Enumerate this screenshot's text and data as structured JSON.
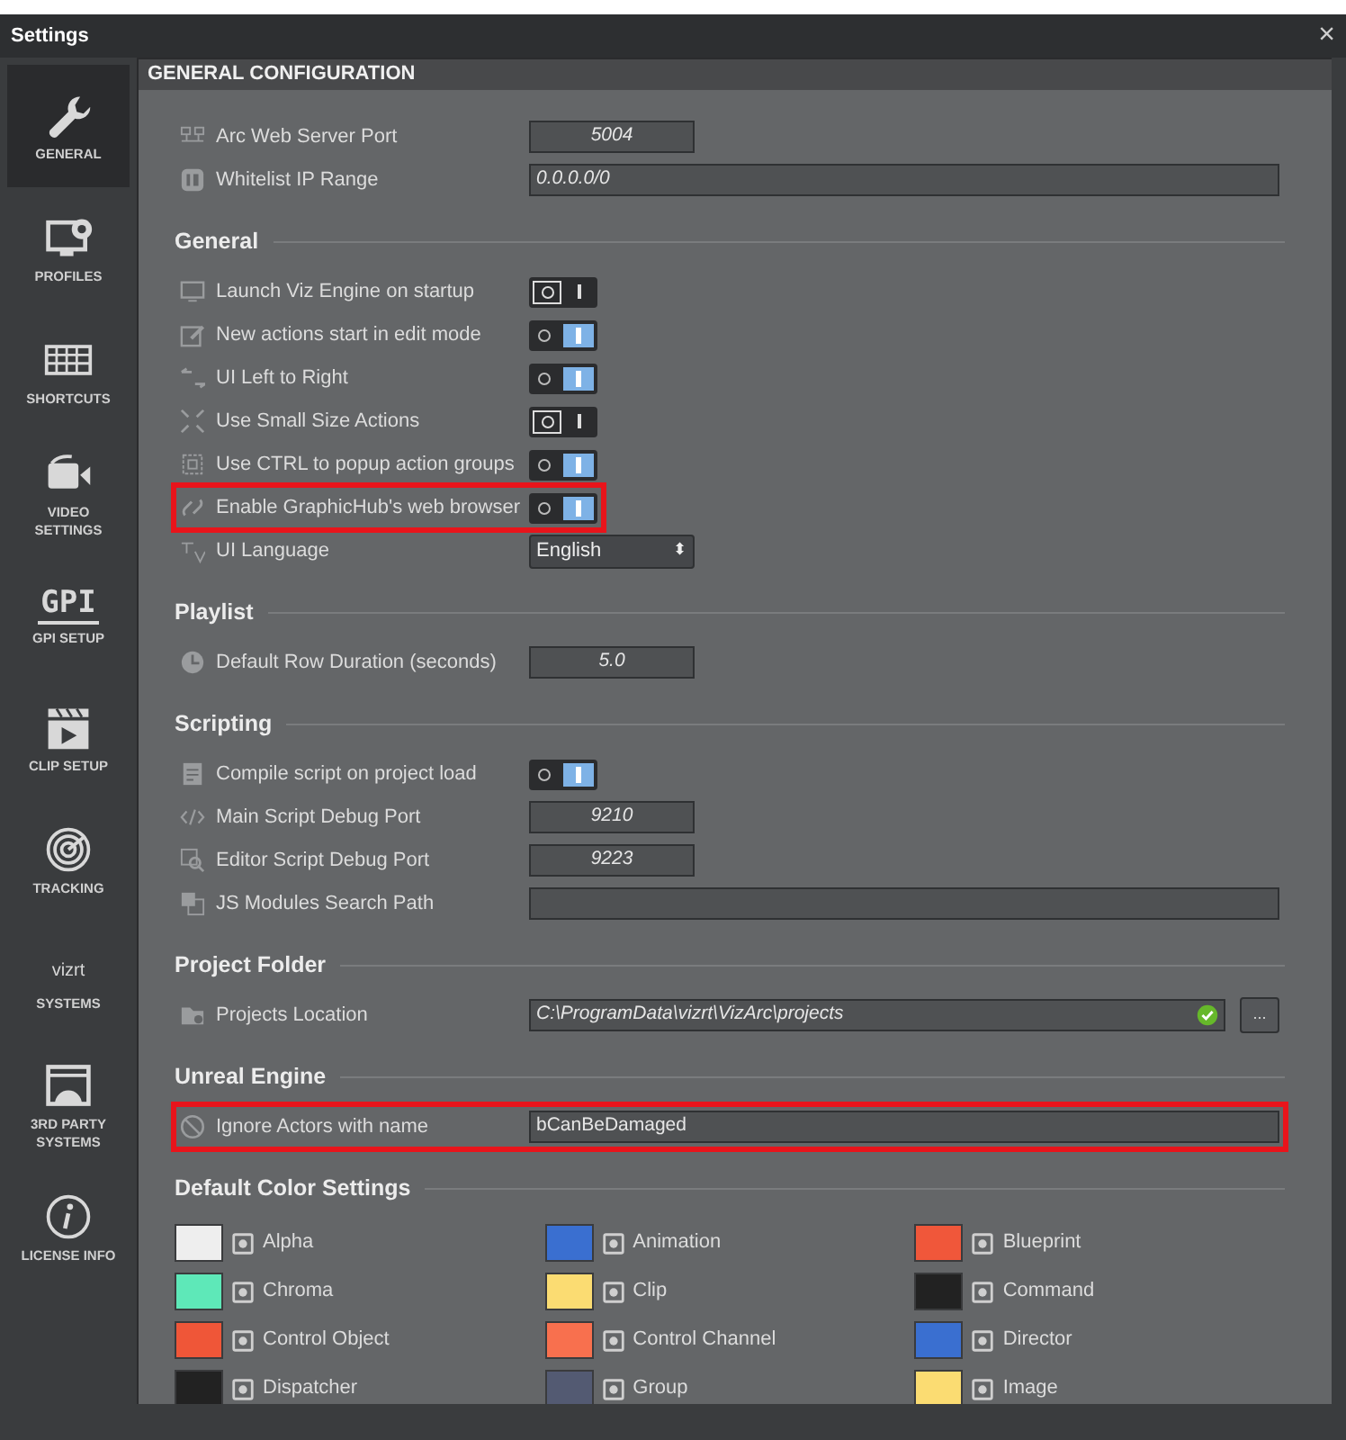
{
  "window": {
    "title": "Settings",
    "close": "×"
  },
  "sidebar": {
    "items": [
      {
        "label": "GENERAL",
        "selected": true
      },
      {
        "label": "PROFILES",
        "selected": false
      },
      {
        "label": "SHORTCUTS",
        "selected": false
      },
      {
        "label": "VIDEO SETTINGS",
        "selected": false
      },
      {
        "label": "GPI SETUP",
        "logo_text": "GPI",
        "selected": false
      },
      {
        "label": "CLIP SETUP",
        "selected": false
      },
      {
        "label": "TRACKING",
        "selected": false
      },
      {
        "label": "SYSTEMS",
        "logo_text": "vizrt",
        "selected": false
      },
      {
        "label": "3RD PARTY SYSTEMS",
        "selected": false
      },
      {
        "label": "LICENSE INFO",
        "selected": false
      }
    ]
  },
  "header": "GENERAL CONFIGURATION",
  "sections": [
    {
      "rows": [
        {
          "kind": "short_field",
          "label": "Arc Web Server Port",
          "value": "5004",
          "highlighted": false
        },
        {
          "kind": "long_field",
          "label": "Whitelist IP Range",
          "value": "0.0.0.0/0",
          "highlighted": false
        }
      ]
    },
    {
      "title": "General",
      "rows": [
        {
          "kind": "toggle",
          "label": "Launch Viz Engine on startup",
          "on": false,
          "highlighted": false
        },
        {
          "kind": "toggle",
          "label": "New actions start in edit mode",
          "on": true,
          "highlighted": false
        },
        {
          "kind": "toggle",
          "label": "UI Left to Right",
          "on": true,
          "highlighted": false
        },
        {
          "kind": "toggle",
          "label": "Use Small Size Actions",
          "on": false,
          "highlighted": false
        },
        {
          "kind": "toggle",
          "label": "Use CTRL to popup action groups",
          "on": true,
          "highlighted": false
        },
        {
          "kind": "toggle",
          "label": "Enable GraphicHub's web browser",
          "on": true,
          "highlighted": true
        },
        {
          "kind": "dropdown",
          "label": "UI Language",
          "value": "English",
          "arrow": "⬍",
          "highlighted": false
        }
      ]
    },
    {
      "title": "Playlist",
      "rows": [
        {
          "kind": "short_field",
          "label": "Default Row Duration (seconds)",
          "value": "5.0",
          "highlighted": false
        }
      ]
    },
    {
      "title": "Scripting",
      "rows": [
        {
          "kind": "toggle",
          "label": "Compile script on project load",
          "on": true,
          "highlighted": false
        },
        {
          "kind": "short_field",
          "label": "Main Script Debug Port",
          "value": "9210",
          "highlighted": false
        },
        {
          "kind": "short_field",
          "label": "Editor Script Debug Port",
          "value": "9223",
          "highlighted": false
        },
        {
          "kind": "long_field",
          "label": "JS Modules Search Path",
          "highlighted": false
        }
      ]
    },
    {
      "title": "Project Folder",
      "rows": [
        {
          "kind": "path",
          "label": "Projects Location",
          "value": "C:\\ProgramData\\vizrt\\VizArc\\projects",
          "button": "...",
          "highlighted": false
        }
      ]
    },
    {
      "title": "Unreal Engine",
      "rows": [
        {
          "kind": "long_field",
          "label": "Ignore Actors with name",
          "value": "bCanBeDamaged",
          "highlighted": true
        }
      ]
    }
  ],
  "color_settings": {
    "title": "Default Color Settings",
    "items": [
      {
        "name": "Alpha",
        "color": "#eeeeee"
      },
      {
        "name": "Animation",
        "color": "#3a6fd0"
      },
      {
        "name": "Blueprint",
        "color": "#f0573a"
      },
      {
        "name": "Chroma",
        "color": "#5ee8b8"
      },
      {
        "name": "Clip",
        "color": "#fbdc72"
      },
      {
        "name": "Command",
        "color": "#222222"
      },
      {
        "name": "Control Object",
        "color": "#ef5638"
      },
      {
        "name": "Control Channel",
        "color": "#f8704e"
      },
      {
        "name": "Director",
        "color": "#3a6fd0"
      },
      {
        "name": "Dispatcher",
        "color": "#222222"
      },
      {
        "name": "Group",
        "color": "#535a72"
      },
      {
        "name": "Image",
        "color": "#fbdc72"
      }
    ]
  }
}
